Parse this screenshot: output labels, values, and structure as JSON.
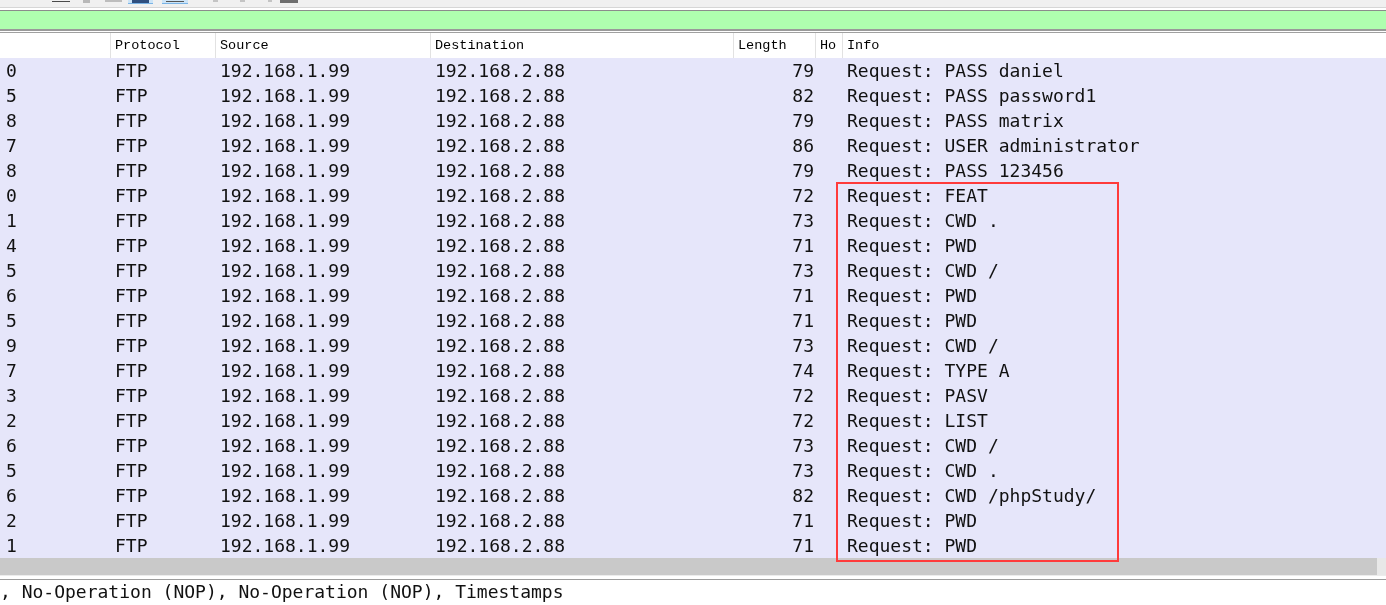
{
  "toolbar": {
    "buttons": [
      {
        "on": false
      },
      {
        "on": false
      },
      {
        "on": false
      },
      {
        "on": true
      },
      {
        "on": true
      },
      {
        "on": false
      },
      {
        "on": false
      },
      {
        "on": false
      },
      {
        "on": false
      }
    ]
  },
  "filter": {
    "valid": true
  },
  "table": {
    "columns": [
      {
        "label": "Protocol"
      },
      {
        "label": "Source"
      },
      {
        "label": "Destination"
      },
      {
        "label": "Length"
      },
      {
        "label": "Ho"
      },
      {
        "label": "Info"
      }
    ],
    "rows": [
      {
        "column_1": "0",
        "protocol": "FTP",
        "source": "192.168.1.99",
        "destination": "192.168.2.88",
        "length": "79",
        "info": "Request: PASS daniel"
      },
      {
        "column_1": "5",
        "protocol": "FTP",
        "source": "192.168.1.99",
        "destination": "192.168.2.88",
        "length": "82",
        "info": "Request: PASS password1"
      },
      {
        "column_1": "8",
        "protocol": "FTP",
        "source": "192.168.1.99",
        "destination": "192.168.2.88",
        "length": "79",
        "info": "Request: PASS matrix"
      },
      {
        "column_1": "7",
        "protocol": "FTP",
        "source": "192.168.1.99",
        "destination": "192.168.2.88",
        "length": "86",
        "info": "Request: USER administrator"
      },
      {
        "column_1": "8",
        "protocol": "FTP",
        "source": "192.168.1.99",
        "destination": "192.168.2.88",
        "length": "79",
        "info": "Request: PASS 123456"
      },
      {
        "column_1": "0",
        "protocol": "FTP",
        "source": "192.168.1.99",
        "destination": "192.168.2.88",
        "length": "72",
        "info": "Request: FEAT"
      },
      {
        "column_1": "1",
        "protocol": "FTP",
        "source": "192.168.1.99",
        "destination": "192.168.2.88",
        "length": "73",
        "info": "Request: CWD ."
      },
      {
        "column_1": "4",
        "protocol": "FTP",
        "source": "192.168.1.99",
        "destination": "192.168.2.88",
        "length": "71",
        "info": "Request: PWD"
      },
      {
        "column_1": "5",
        "protocol": "FTP",
        "source": "192.168.1.99",
        "destination": "192.168.2.88",
        "length": "73",
        "info": "Request: CWD /"
      },
      {
        "column_1": "6",
        "protocol": "FTP",
        "source": "192.168.1.99",
        "destination": "192.168.2.88",
        "length": "71",
        "info": "Request: PWD"
      },
      {
        "column_1": "5",
        "protocol": "FTP",
        "source": "192.168.1.99",
        "destination": "192.168.2.88",
        "length": "71",
        "info": "Request: PWD"
      },
      {
        "column_1": "9",
        "protocol": "FTP",
        "source": "192.168.1.99",
        "destination": "192.168.2.88",
        "length": "73",
        "info": "Request: CWD /"
      },
      {
        "column_1": "7",
        "protocol": "FTP",
        "source": "192.168.1.99",
        "destination": "192.168.2.88",
        "length": "74",
        "info": "Request: TYPE A"
      },
      {
        "column_1": "3",
        "protocol": "FTP",
        "source": "192.168.1.99",
        "destination": "192.168.2.88",
        "length": "72",
        "info": "Request: PASV"
      },
      {
        "column_1": "2",
        "protocol": "FTP",
        "source": "192.168.1.99",
        "destination": "192.168.2.88",
        "length": "72",
        "info": "Request: LIST"
      },
      {
        "column_1": "6",
        "protocol": "FTP",
        "source": "192.168.1.99",
        "destination": "192.168.2.88",
        "length": "73",
        "info": "Request: CWD /"
      },
      {
        "column_1": "5",
        "protocol": "FTP",
        "source": "192.168.1.99",
        "destination": "192.168.2.88",
        "length": "73",
        "info": "Request: CWD ."
      },
      {
        "column_1": "6",
        "protocol": "FTP",
        "source": "192.168.1.99",
        "destination": "192.168.2.88",
        "length": "82",
        "info": "Request: CWD /phpStudy/"
      },
      {
        "column_1": "2",
        "protocol": "FTP",
        "source": "192.168.1.99",
        "destination": "192.168.2.88",
        "length": "71",
        "info": "Request: PWD"
      },
      {
        "column_1": "1",
        "protocol": "FTP",
        "source": "192.168.1.99",
        "destination": "192.168.2.88",
        "length": "71",
        "info": "Request: PWD"
      }
    ]
  },
  "annotation": {
    "kind": "outline"
  },
  "packet_details": {
    "text": ", No-Operation (NOP), No-Operation (NOP), Timestamps"
  }
}
